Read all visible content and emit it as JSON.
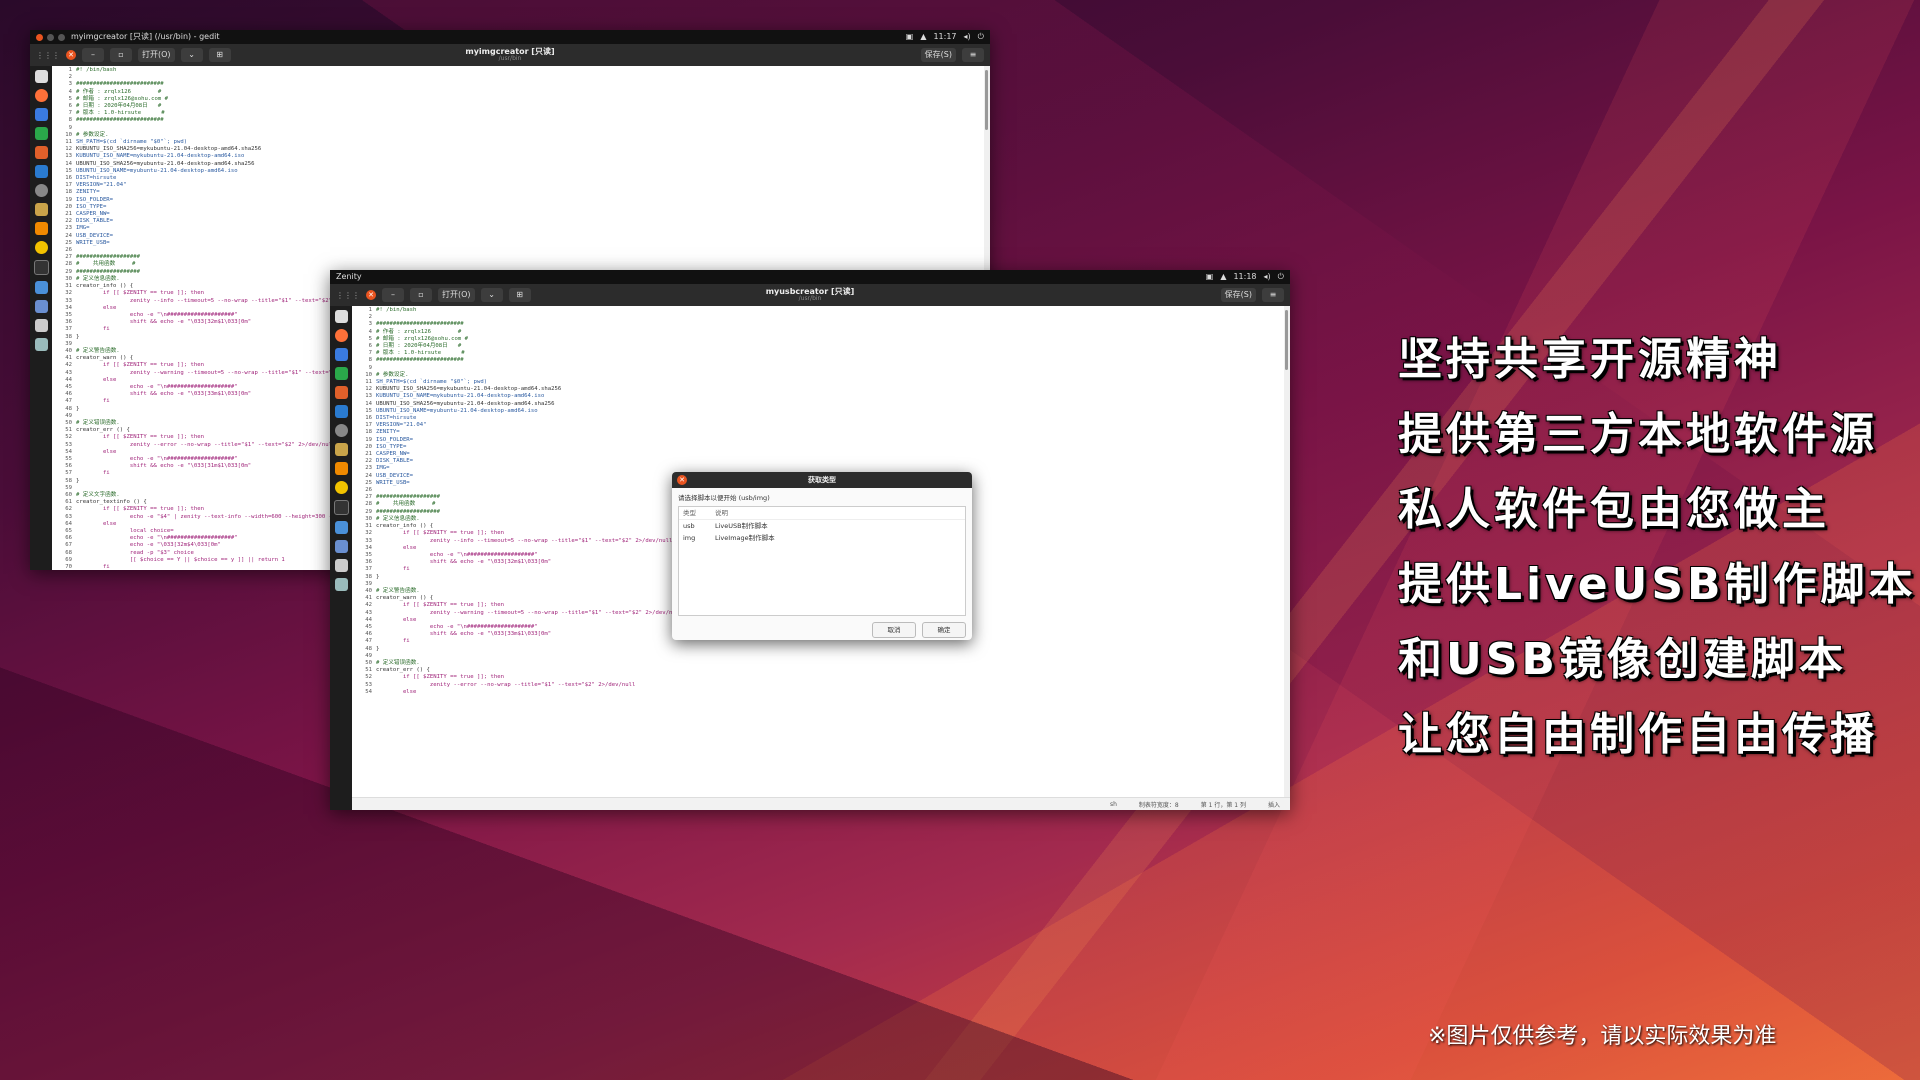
{
  "slogan": {
    "lines": [
      "坚持共享开源精神",
      "提供第三方本地软件源",
      "私人软件包由您做主",
      "提供LiveUSB制作脚本",
      "和USB镜像创建脚本",
      "让您自由制作自由传播"
    ]
  },
  "footnote": "※图片仅供参考，请以实际效果为准",
  "win1": {
    "topbar_title": "myimgcreator [只读] (/usr/bin) - gedit",
    "clock": "11:17",
    "open_label": "打开(O)",
    "title": "myimgcreator [只读]",
    "subtitle": "/usr/bin",
    "save_label": "保存(S)"
  },
  "win2": {
    "topbar_title": "Zenity",
    "clock": "11:18",
    "open_label": "打开(O)",
    "title": "myusbcreator [只读]",
    "subtitle": "/usr/bin",
    "save_label": "保存(S)",
    "status": {
      "lang": "sh",
      "tab": "制表符宽度：8",
      "pos": "第 1 行，第 1 列",
      "mode": "插入"
    }
  },
  "dialog": {
    "title": "获取类型",
    "prompt": "请选择脚本以便开始 (usb/img)",
    "col_type": "类型",
    "col_desc": "说明",
    "rows": [
      {
        "type": "usb",
        "desc": "LiveUSB制作脚本"
      },
      {
        "type": "img",
        "desc": "LiveImage制作脚本"
      }
    ],
    "cancel": "取消",
    "ok": "确定"
  },
  "code": [
    "#! /bin/bash",
    "",
    "##########################",
    "# 作者 : zrqlx126        #",
    "# 邮箱 : zrqlx126@sohu.com #",
    "# 日期 : 2020年04月08日   #",
    "# 版本 : 1.0-hirsute      #",
    "##########################",
    "",
    "# 参数设定.",
    "SH_PATH=$(cd `dirname \"$0\"`; pwd)",
    "KUBUNTU_ISO_SHA256=mykubuntu-21.04-desktop-amd64.sha256",
    "KUBUNTU_ISO_NAME=mykubuntu-21.04-desktop-amd64.iso",
    "UBUNTU_ISO_SHA256=myubuntu-21.04-desktop-amd64.sha256",
    "UBUNTU_ISO_NAME=myubuntu-21.04-desktop-amd64.iso",
    "DIST=hirsute",
    "VERSION=\"21.04\"",
    "ZENITY=",
    "ISO_FOLDER=",
    "ISO_TYPE=",
    "CASPER_NW=",
    "DISK_TABLE=",
    "IMG=",
    "USB_DEVICE=",
    "WRITE_USB=",
    "",
    "###################",
    "#    共用函数     #",
    "###################",
    "# 定义信息函数.",
    "creator_info () {",
    "        if [[ $ZENITY == true ]]; then",
    "                zenity --info --timeout=5 --no-wrap --title=\"$1\" --text=\"$2\" 2>/dev/null",
    "        else",
    "                echo -e \"\\n####################\"",
    "                shift && echo -e \"\\033[32m$1\\033[0m\"",
    "        fi",
    "}",
    "",
    "# 定义警告函数.",
    "creator_warn () {",
    "        if [[ $ZENITY == true ]]; then",
    "                zenity --warning --timeout=5 --no-wrap --title=\"$1\" --text=\"$2\" 2>/dev/null",
    "        else",
    "                echo -e \"\\n####################\"",
    "                shift && echo -e \"\\033[33m$1\\033[0m\"",
    "        fi",
    "}",
    "",
    "# 定义错误函数.",
    "creator_err () {",
    "        if [[ $ZENITY == true ]]; then",
    "                zenity --error --no-wrap --title=\"$1\" --text=\"$2\" 2>/dev/null",
    "        else",
    "                echo -e \"\\n####################\"",
    "                shift && echo -e \"\\033[31m$1\\033[0m\"",
    "        fi",
    "}",
    "",
    "# 定义文字函数.",
    "creator_textinfo () {",
    "        if [[ $ZENITY == true ]]; then",
    "                echo -e \"$4\" | zenity --text-info --width=600 --height=300 --title=\"$1\" --checkbox=\"$2\" 2>/dev/null || return 1",
    "        else",
    "                local choice=",
    "                echo -e \"\\n####################\"",
    "                echo -e \"\\033[32m$4\\033[0m\"",
    "                read -p \"$3\" choice",
    "                [[ $choice == Y || $choice == y ]] || return 1",
    "        fi"
  ]
}
